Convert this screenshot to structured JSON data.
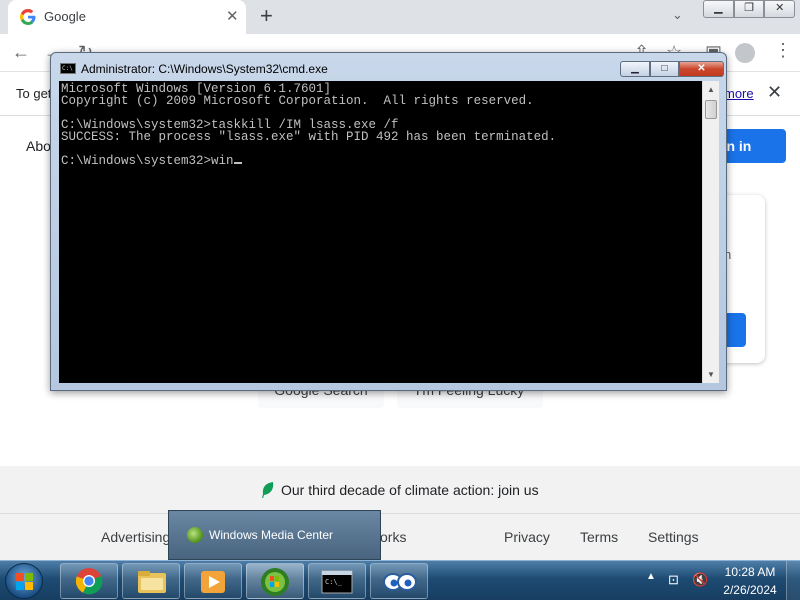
{
  "browser": {
    "tab_title": "Google",
    "tab_close": "✕",
    "new_tab": "+",
    "infobar_text": "To get",
    "infobar_link": "more",
    "infobar_close": "✕"
  },
  "google_page": {
    "about_link": "Abo",
    "signin_label": "ign in",
    "card_text": "h",
    "search_button": "Google Search",
    "lucky_button": "I'm Feeling Lucky",
    "climate_text": "Our third decade of climate action: join us",
    "footer_links": [
      "Advertising",
      "orks",
      "Privacy",
      "Terms",
      "Settings"
    ]
  },
  "cmd": {
    "title": "Administrator: C:\\Windows\\System32\\cmd.exe",
    "lines": [
      "Microsoft Windows [Version 6.1.7601]",
      "Copyright (c) 2009 Microsoft Corporation.  All rights reserved.",
      "",
      "C:\\Windows\\system32>taskkill /IM lsass.exe /f",
      "SUCCESS: The process \"lsass.exe\" with PID 492 has been terminated.",
      "",
      "C:\\Windows\\system32>win"
    ]
  },
  "taskbar": {
    "tooltip": "Windows Media Center",
    "time": "10:28 AM",
    "date": "2/26/2024",
    "buttons": [
      "chrome",
      "windows-explorer",
      "windows-media-player",
      "windows-media-center",
      "command-prompt",
      "remote-assistance"
    ]
  },
  "icons": [
    "google-g-icon",
    "back-arrow-icon",
    "reload-icon",
    "star-icon",
    "extensions-icon",
    "avatar-icon",
    "menu-icon",
    "leaf-icon",
    "start-orb-icon",
    "network-icon",
    "volume-muted-icon"
  ],
  "colors": {
    "accent": "#1a73e8",
    "console_bg": "#000000",
    "console_text": "#c0c0c0",
    "taskbar": "#1d4b73"
  }
}
